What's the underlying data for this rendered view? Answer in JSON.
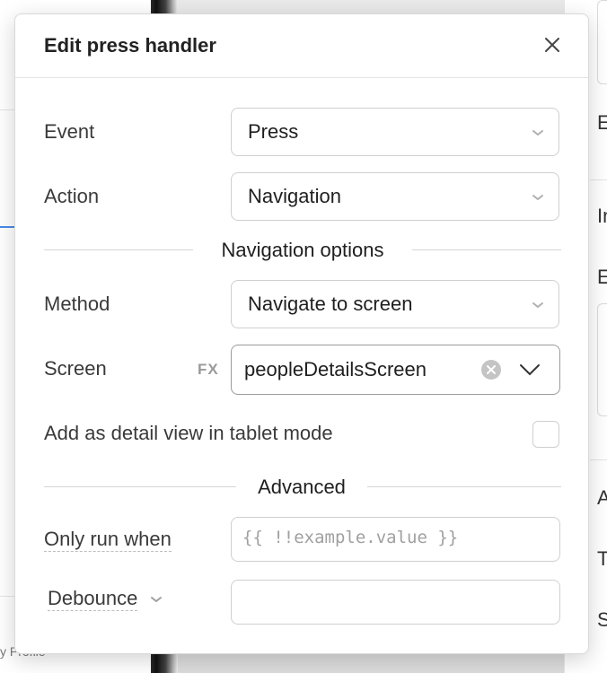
{
  "background": {
    "left_fragment_text": "y Profile",
    "right_fragments": [
      "E",
      "In",
      "E",
      "A",
      "T",
      "S"
    ]
  },
  "modal": {
    "title": "Edit press handler",
    "close_icon": "close-icon"
  },
  "form": {
    "event": {
      "label": "Event",
      "value": "Press"
    },
    "action": {
      "label": "Action",
      "value": "Navigation"
    },
    "navigation_section_title": "Navigation options",
    "method": {
      "label": "Method",
      "value": "Navigate to screen"
    },
    "screen": {
      "label": "Screen",
      "fx_label": "FX",
      "value": "peopleDetailsScreen"
    },
    "tablet_mode": {
      "label": "Add as detail view in tablet mode",
      "checked": false
    },
    "advanced_section_title": "Advanced",
    "only_run_when": {
      "label": "Only run when",
      "placeholder": "{{ !!example.value }}"
    },
    "debounce": {
      "label": "Debounce",
      "value": ""
    }
  },
  "colors": {
    "accent_blue": "#4a8ae8",
    "border": "#cfcfcf",
    "muted_text": "#9a9a9a"
  }
}
